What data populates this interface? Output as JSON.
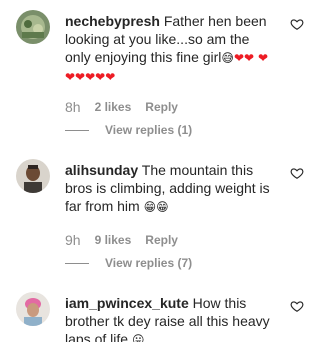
{
  "comments": [
    {
      "username": "nechebypresh",
      "text": "Father hen been looking at you like...so am the only enjoying this fine girl",
      "emoji_tail": "😅",
      "hearts_line1": "❤❤",
      "hearts_line2": "❤❤❤❤❤❤",
      "time": "8h",
      "likes": "2 likes",
      "reply_label": "Reply",
      "view_replies": "View replies (1)"
    },
    {
      "username": "alihsunday",
      "text": "The mountain this bros is climbing, adding weight is far from him",
      "emoji_tail": "😁😁",
      "time": "9h",
      "likes": "9 likes",
      "reply_label": "Reply",
      "view_replies": "View replies (7)"
    },
    {
      "username": "iam_pwincex_kute",
      "text": "How this brother tk dey raise all this heavy laps of life",
      "emoji_tail": "😛"
    }
  ],
  "colors": {
    "text": "#262626",
    "muted": "#8e8e8e",
    "heart": "#ed1c24"
  },
  "icons": {
    "like": "heart-outline-icon"
  }
}
